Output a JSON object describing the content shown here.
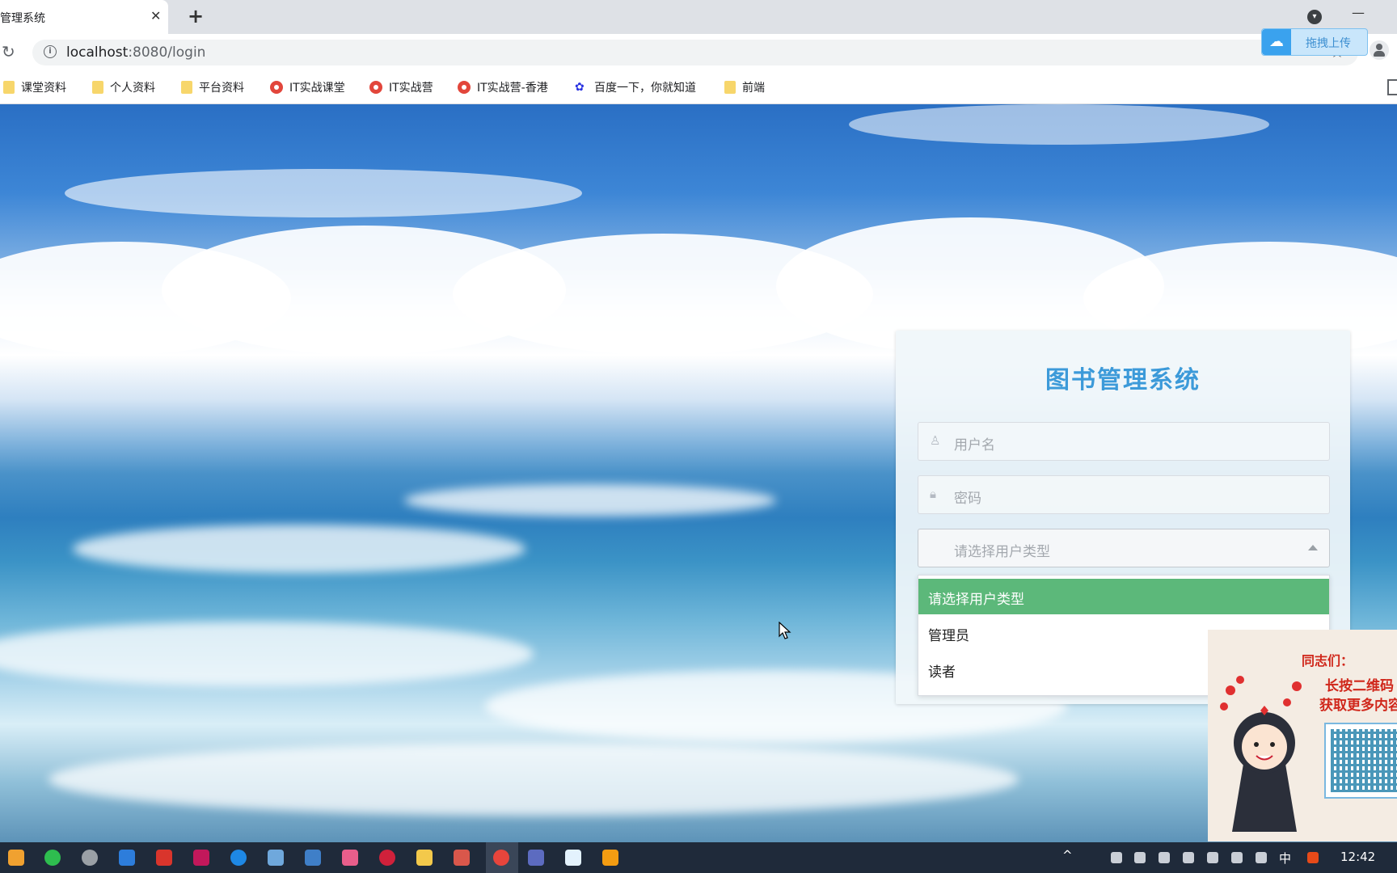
{
  "browser": {
    "tab_title": "管理系统",
    "tab_close": "✕",
    "new_tab": "+",
    "url_host": "localhost",
    "url_path": ":8080/login",
    "upload_button_label": "拖拽上传"
  },
  "bookmarks": [
    {
      "label": "课堂资料",
      "icon": "folder-icon"
    },
    {
      "label": "个人资料",
      "icon": "folder-icon"
    },
    {
      "label": "平台资料",
      "icon": "folder-icon"
    },
    {
      "label": "IT实战课堂",
      "icon": "site-icon"
    },
    {
      "label": "IT实战营",
      "icon": "site-icon"
    },
    {
      "label": "IT实战营-香港",
      "icon": "site-icon"
    },
    {
      "label": "百度一下，你就知道",
      "icon": "baidu-paw-icon"
    },
    {
      "label": "前端",
      "icon": "folder-icon"
    }
  ],
  "login": {
    "title": "图书管理系统",
    "username_placeholder": "用户名",
    "password_placeholder": "密码",
    "user_type_placeholder": "请选择用户类型",
    "user_type_options": [
      "请选择用户类型",
      "管理员",
      "读者"
    ],
    "selected_option_index": 0
  },
  "ad": {
    "title": "同志们：",
    "line1": "长按二维码",
    "line2": "获取更多内容"
  },
  "taskbar": {
    "input_method": "中",
    "clock": "12:42"
  },
  "colors": {
    "title_blue": "#3c9ad9",
    "selected_option_green": "#5cb87a",
    "ad_red": "#d0271b"
  }
}
